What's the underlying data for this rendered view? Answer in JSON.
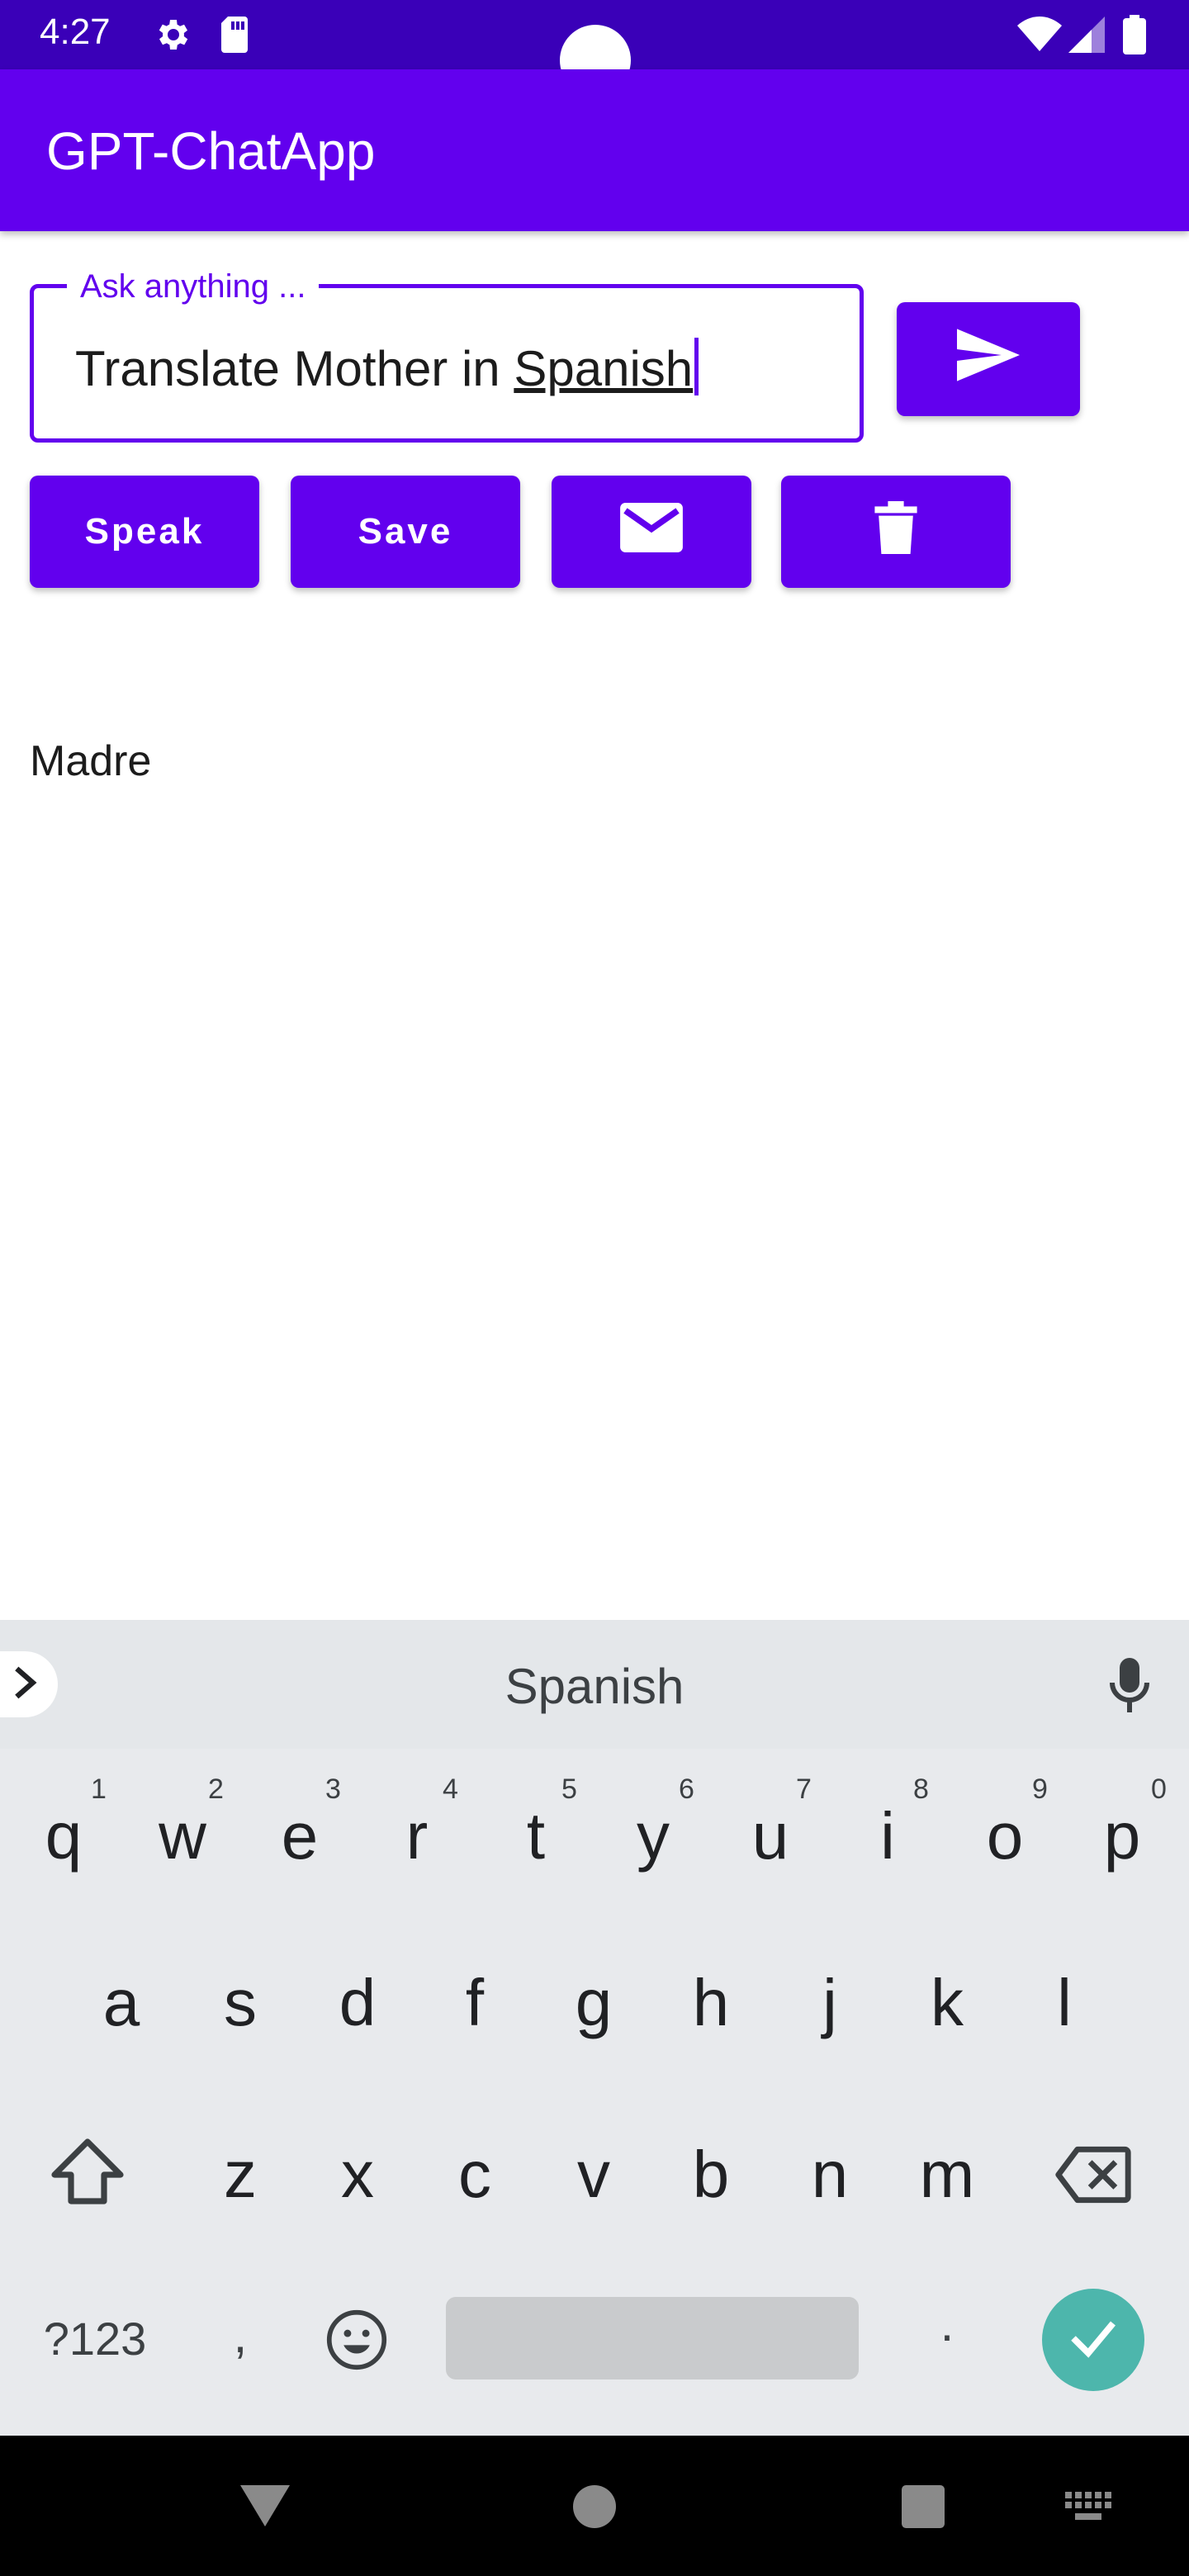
{
  "status_bar": {
    "time": "4:27",
    "icons": [
      "gear-icon",
      "sd-card-icon",
      "wifi-icon",
      "signal-icon",
      "battery-icon"
    ]
  },
  "app_bar": {
    "title": "GPT-ChatApp"
  },
  "input": {
    "label": "Ask anything ...",
    "value_prefix": "Translate Mother in ",
    "value_underlined": "Spanish"
  },
  "buttons": {
    "speak": "Speak",
    "save": "Save"
  },
  "response": {
    "text": "Madre"
  },
  "keyboard": {
    "suggestion": "Spanish",
    "row1": [
      "q",
      "w",
      "e",
      "r",
      "t",
      "y",
      "u",
      "i",
      "o",
      "p"
    ],
    "row1_hints": [
      "1",
      "2",
      "3",
      "4",
      "5",
      "6",
      "7",
      "8",
      "9",
      "0"
    ],
    "row2": [
      "a",
      "s",
      "d",
      "f",
      "g",
      "h",
      "j",
      "k",
      "l"
    ],
    "row3": [
      "z",
      "x",
      "c",
      "v",
      "b",
      "n",
      "m"
    ],
    "symbols_key": "?123",
    "comma_key": ",",
    "period_key": "."
  },
  "colors": {
    "primary": "#6200ee",
    "status_bar": "#3a00b8",
    "enter_key": "#4db6ac"
  }
}
